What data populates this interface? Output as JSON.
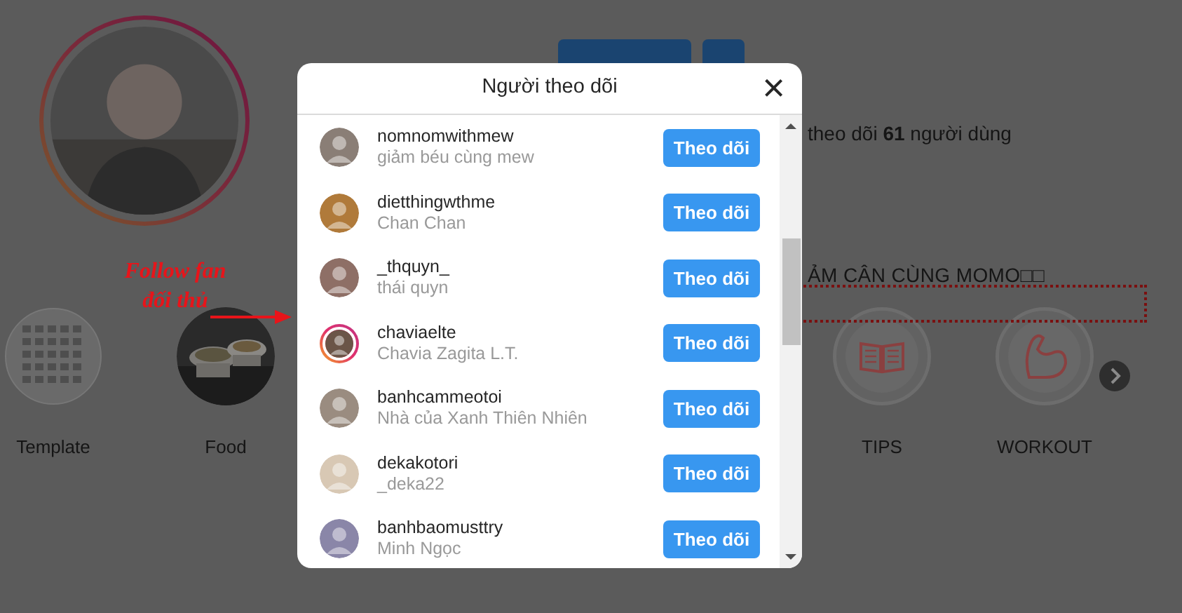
{
  "profile": {
    "following_text": "theo dõi **61** người dùng",
    "bio_title": "ẢM CÂN CÙNG MOMO□□"
  },
  "annotation": {
    "text": "Follow fan đối thủ"
  },
  "highlights": [
    {
      "label": "Template",
      "kind": "grid"
    },
    {
      "label": "Food"
    },
    {
      "label": "TIPS",
      "kind": "book"
    },
    {
      "label": "WORKOUT",
      "kind": "arm"
    }
  ],
  "modal": {
    "title": "Người theo dõi",
    "close": "×",
    "followers": [
      {
        "username": "nomnomwithmew",
        "full_name": "giảm béu cùng mew",
        "button": "Theo dõi",
        "story_ring": false,
        "color": "#8a7e76"
      },
      {
        "username": "dietthingwthme",
        "full_name": "Chan Chan",
        "button": "Theo dõi",
        "story_ring": false,
        "color": "#b07a3a"
      },
      {
        "username": "_thquyn_",
        "full_name": "thái quyn",
        "button": "Theo dõi",
        "story_ring": false,
        "color": "#8e6f66"
      },
      {
        "username": "chaviaelte",
        "full_name": "Chavia Zagita L.T.",
        "button": "Theo dõi",
        "story_ring": true,
        "color": "#6b5548"
      },
      {
        "username": "banhcammeotoi",
        "full_name": "Nhà của Xanh Thiên Nhiên",
        "button": "Theo dõi",
        "story_ring": false,
        "color": "#9a8c80"
      },
      {
        "username": "dekakotori",
        "full_name": "_deka22",
        "button": "Theo dõi",
        "story_ring": false,
        "color": "#d8c8b4"
      },
      {
        "username": "banhbaomusttry",
        "full_name": "Minh Ngọc",
        "button": "Theo dõi",
        "story_ring": false,
        "color": "#8a86a8"
      }
    ]
  }
}
